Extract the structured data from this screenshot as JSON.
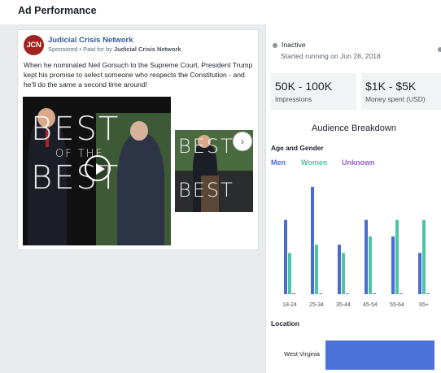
{
  "header": {
    "title": "Ad Performance"
  },
  "ad": {
    "avatar_text": "JCN",
    "page_name": "Judicial Crisis Network",
    "sponsored_label": "Sponsored",
    "paid_for_prefix": " • Paid for by ",
    "paid_for_by": "Judicial Crisis Network",
    "body_text": "When he nominated Neil Gorsuch to the Supreme Court, President Trump kept his promise to select someone who respects the Constitution - and he'll do the same a second time around!",
    "media_overlay_text": [
      "BEST",
      "OF THE",
      "BEST"
    ],
    "next_glyph": "›"
  },
  "status": {
    "state": "Inactive",
    "started": "Started running on Jun 28, 2018"
  },
  "stats": {
    "impressions_value": "50K - 100K",
    "impressions_label": "Impressions",
    "spend_value": "$1K - $5K",
    "spend_label": "Money spent (USD)"
  },
  "audience": {
    "title": "Audience Breakdown",
    "age_gender_title": "Age and Gender",
    "legend": {
      "men": "Men",
      "women": "Women",
      "unknown": "Unknown"
    }
  },
  "colors": {
    "men": "#4a6ccf",
    "women": "#4dc4a6",
    "unknown": "#9a60d6",
    "location_bar": "#4a72d9"
  },
  "chart_data": {
    "type": "bar",
    "categories": [
      "18-24",
      "25-34",
      "35-44",
      "45-54",
      "55-64",
      "65+"
    ],
    "series": [
      {
        "name": "Men",
        "values": [
          9,
          13,
          6,
          9,
          7,
          5
        ]
      },
      {
        "name": "Women",
        "values": [
          5,
          6,
          5,
          7,
          9,
          9
        ]
      },
      {
        "name": "Unknown",
        "values": [
          0.1,
          0.1,
          0.1,
          0.1,
          0.1,
          0.1
        ]
      }
    ],
    "ylim": [
      0,
      13
    ],
    "grid": false
  },
  "location": {
    "title": "Location",
    "items": [
      {
        "label": "West Virginia",
        "value": 1.0
      }
    ]
  }
}
